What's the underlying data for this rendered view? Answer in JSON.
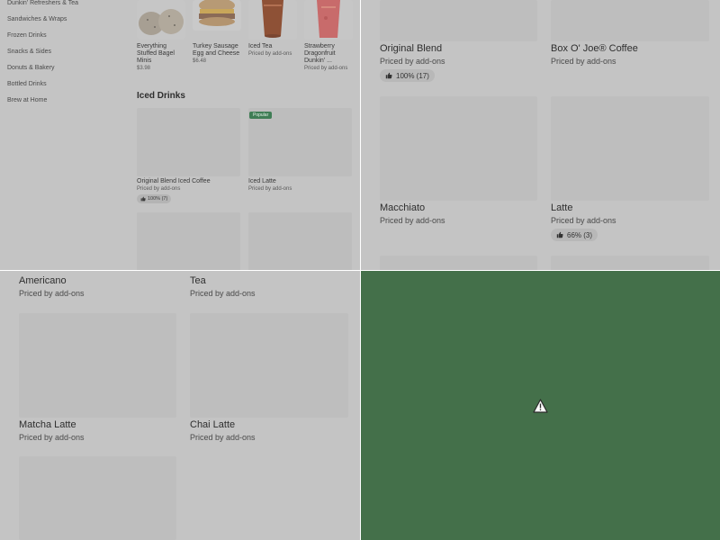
{
  "sidebar": {
    "items": [
      {
        "label": "Dunkin' Refreshers & Tea"
      },
      {
        "label": "Sandwiches & Wraps"
      },
      {
        "label": "Frozen Drinks"
      },
      {
        "label": "Snacks & Sides"
      },
      {
        "label": "Donuts & Bakery"
      },
      {
        "label": "Bottled Drinks"
      },
      {
        "label": "Brew at Home"
      }
    ]
  },
  "featured": [
    {
      "name": "Everything Stuffed Bagel Minis",
      "price": "$3.98"
    },
    {
      "name": "Turkey Sausage Egg and Cheese",
      "price": "$6.48"
    },
    {
      "name": "Iced Tea",
      "price": "Priced by add-ons"
    },
    {
      "name": "Strawberry Dragonfruit Dunkin' ...",
      "price": "Priced by add-ons"
    }
  ],
  "iced_drinks": {
    "title": "Iced Drinks",
    "badge": "Popular",
    "items": [
      {
        "name": "Original Blend Iced Coffee",
        "price": "Priced by add-ons",
        "rating": "100% (7)"
      },
      {
        "name": "Iced Latte",
        "price": "Priced by add-ons"
      }
    ]
  },
  "hot_drinks": [
    {
      "name": "Original Blend",
      "price": "Priced by add-ons",
      "rating": "100% (17)"
    },
    {
      "name": "Box O' Joe® Coffee",
      "price": "Priced by add-ons"
    },
    {
      "name": "Macchiato",
      "price": "Priced by add-ons"
    },
    {
      "name": "Latte",
      "price": "Priced by add-ons",
      "rating": "66% (3)"
    }
  ],
  "more_drinks": [
    {
      "name": "Americano",
      "price": "Priced by add-ons"
    },
    {
      "name": "Tea",
      "price": "Priced by add-ons"
    },
    {
      "name": "Matcha Latte",
      "price": "Priced by add-ons"
    },
    {
      "name": "Chai Latte",
      "price": "Priced by add-ons"
    }
  ],
  "colors": {
    "overlay_gray": "#c4c4c4",
    "error_panel": "#44704a",
    "badge_green": "#3f7d55"
  },
  "icons": [
    "thumbs-up-icon",
    "warning-icon"
  ]
}
